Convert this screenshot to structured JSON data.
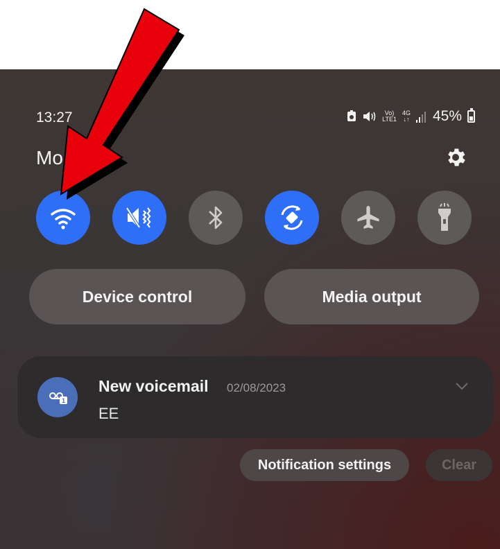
{
  "status_bar": {
    "time": "13:27",
    "network_top": "Vo)",
    "network_bottom": "LTE1",
    "data_top": "4G",
    "data_bottom": "↓↑",
    "battery": "45%",
    "battery_level": 0.45,
    "icons": [
      "auto-rotate-lock-icon",
      "mute-icon",
      "volte-icon",
      "4g-icon",
      "signal-icon",
      "battery-icon"
    ]
  },
  "carrier_name": "Mo      ug",
  "quick_settings": [
    {
      "name": "wifi",
      "state": "on",
      "icon": "wifi-icon"
    },
    {
      "name": "mute",
      "state": "on",
      "icon": "mute-icon"
    },
    {
      "name": "bluetooth",
      "state": "off",
      "icon": "bluetooth-icon"
    },
    {
      "name": "auto-rotate",
      "state": "on",
      "icon": "auto-rotate-icon"
    },
    {
      "name": "airplane-mode",
      "state": "off",
      "icon": "airplane-icon"
    },
    {
      "name": "flashlight",
      "state": "off",
      "icon": "flashlight-icon"
    }
  ],
  "buttons": {
    "device_control": "Device control",
    "media_output": "Media output"
  },
  "notification": {
    "title": "New voicemail",
    "date": "02/08/2023",
    "body": "EE",
    "icon": "voicemail-icon"
  },
  "footer": {
    "settings": "Notification settings",
    "clear": "Clear"
  },
  "colors": {
    "active_tile": "#2f6ef7",
    "inactive_tile": "#5e5a59",
    "arrow": "#e8000b"
  }
}
